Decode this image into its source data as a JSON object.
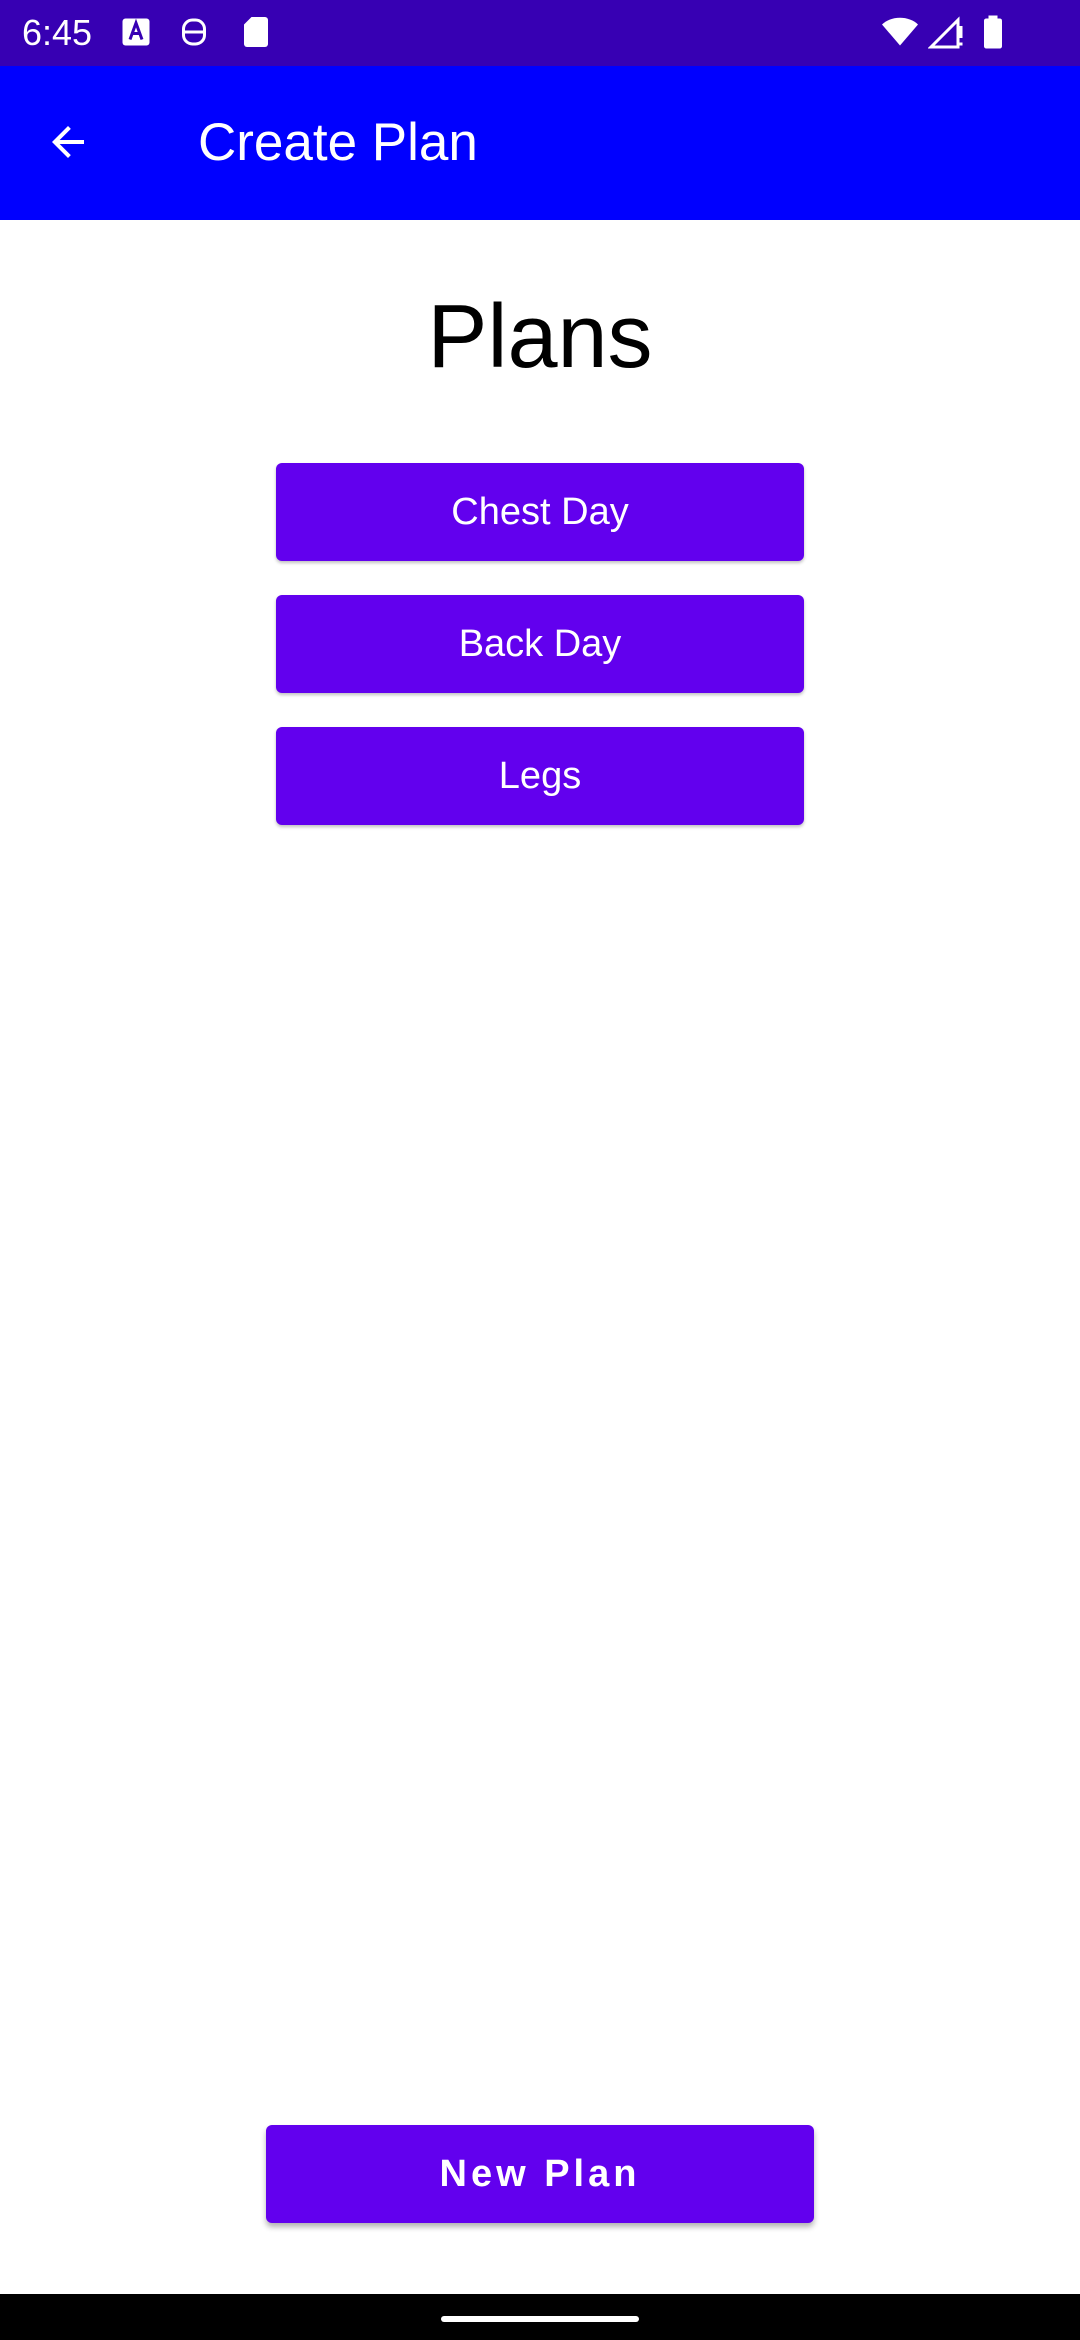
{
  "status_bar": {
    "time": "6:45",
    "left_icons": [
      "font-a-icon",
      "robot-face-icon",
      "sd-card-icon"
    ],
    "right_icons": [
      "wifi-icon",
      "signal-icon",
      "battery-icon"
    ],
    "background_color": "#3700b3"
  },
  "app_bar": {
    "title": "Create Plan",
    "back_icon": "arrow-back-icon",
    "background_color": "#0000ff"
  },
  "main": {
    "heading": "Plans",
    "plans": [
      {
        "label": "Chest Day"
      },
      {
        "label": "Back Day"
      },
      {
        "label": "Legs"
      }
    ],
    "button_color": "#6200ee"
  },
  "footer": {
    "new_plan_label": "New Plan"
  }
}
